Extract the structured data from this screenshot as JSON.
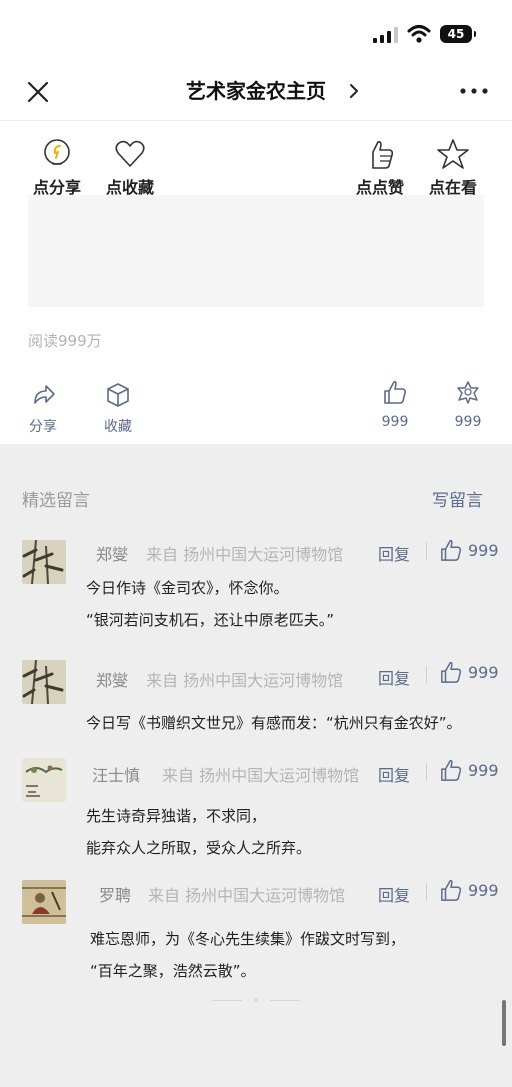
{
  "status_bar": {
    "battery": "45"
  },
  "nav": {
    "title": "艺术家金农主页",
    "chevron": "›"
  },
  "top_actions": [
    {
      "label": "点分享",
      "icon": "bulb-icon"
    },
    {
      "label": "点收藏",
      "icon": "heart-icon"
    },
    {
      "label": "点点赞",
      "icon": "thumbs-up-icon"
    },
    {
      "label": "点在看",
      "icon": "star-icon"
    }
  ],
  "reads": "阅读999万",
  "bottom_actions": {
    "share": "分享",
    "collect": "收藏",
    "like_count": "999",
    "wow_count": "999"
  },
  "comments": {
    "heading": "精选留言",
    "write": "写留言",
    "reply_label": "回复",
    "from_prefix": "来自",
    "items": [
      {
        "name": "郑燮",
        "location": "扬州中国大运河博物馆",
        "likes": "999",
        "lines": [
          "今日作诗《金司农》，怀念你。",
          "“银河若问支机石，还让中原老匹夫。”"
        ]
      },
      {
        "name": "郑燮",
        "location": "扬州中国大运河博物馆",
        "likes": "999",
        "lines": [
          "今日写《书赠织文世兄》有感而发：“杭州只有金农好”。"
        ]
      },
      {
        "name": "汪士慎",
        "location": "扬州中国大运河博物馆",
        "likes": "999",
        "lines": [
          "先生诗奇异独谐，不求同，",
          "能弃众人之所取，受众人之所弃。"
        ]
      },
      {
        "name": "罗聘",
        "location": "扬州中国大运河博物馆",
        "likes": "999",
        "lines": [
          "难忘恩师，为《冬心先生续集》作跋文时写到，",
          "“百年之聚，浩然云散”。"
        ]
      }
    ]
  },
  "colors": {
    "link_blue": "#5b6b8c",
    "panel_grey": "#eeeeee",
    "bulb_yellow": "#f0b400"
  }
}
